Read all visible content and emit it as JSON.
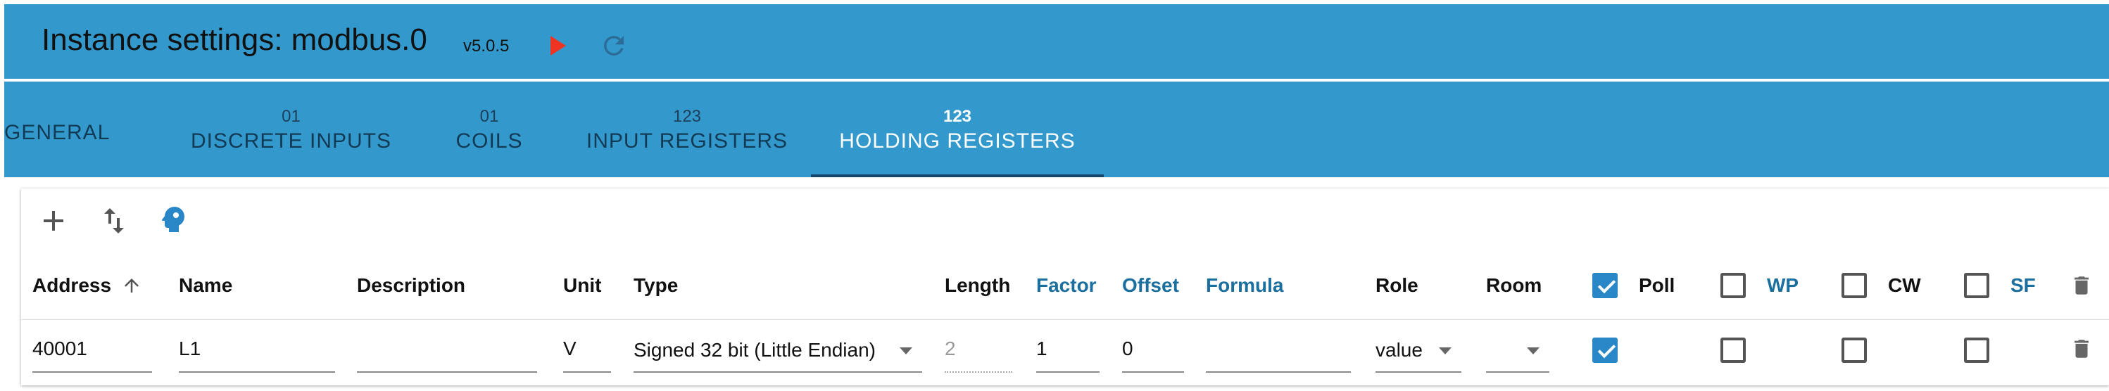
{
  "header": {
    "title": "Instance settings: modbus.0",
    "version": "v5.0.5",
    "play_icon": "play-icon",
    "reload_icon": "reload-icon"
  },
  "tabs": [
    {
      "label": "GENERAL",
      "count": ""
    },
    {
      "label": "DISCRETE INPUTS",
      "count": "01"
    },
    {
      "label": "COILS",
      "count": "01"
    },
    {
      "label": "INPUT REGISTERS",
      "count": "123"
    },
    {
      "label": "HOLDING REGISTERS",
      "count": "123",
      "active": true
    }
  ],
  "toolbar": {
    "add_icon": "add-icon",
    "sort_icon": "sort-icon",
    "robot_icon": "robot-head-icon"
  },
  "columns": {
    "address": "Address",
    "name": "Name",
    "description": "Description",
    "unit": "Unit",
    "type": "Type",
    "length": "Length",
    "factor": "Factor",
    "offset": "Offset",
    "formula": "Formula",
    "role": "Role",
    "room": "Room",
    "poll": "Poll",
    "wp": "WP",
    "cw": "CW",
    "sf": "SF"
  },
  "header_checks": {
    "poll": true,
    "wp": false,
    "cw": false,
    "sf": false
  },
  "row": {
    "address": "40001",
    "name": "L1",
    "description": "",
    "unit": "V",
    "type": "Signed 32 bit (Little Endian)",
    "length": "2",
    "factor": "1",
    "offset": "0",
    "formula": "",
    "role": "value",
    "room": "",
    "poll": true,
    "wp": false,
    "cw": false,
    "sf": false
  },
  "colors": {
    "header_bg": "#3399CC",
    "active_indicator": "#15466e",
    "accent": "#2a87c7",
    "play": "#ee3322"
  }
}
